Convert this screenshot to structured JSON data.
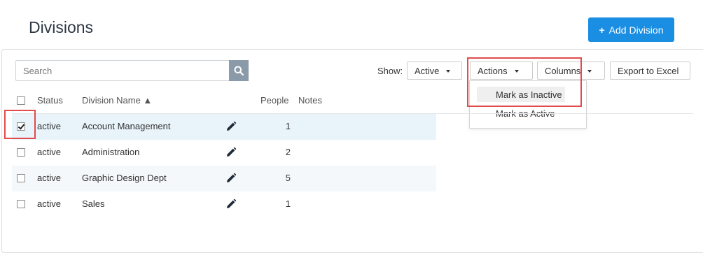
{
  "page": {
    "title": "Divisions"
  },
  "header": {
    "add_button_label": "Add Division",
    "add_button_icon": "plus-icon"
  },
  "toolbar": {
    "search_placeholder": "Search",
    "show_label": "Show:",
    "show_value": "Active",
    "actions_label": "Actions",
    "columns_label": "Columns",
    "export_label": "Export to Excel"
  },
  "actions_menu": {
    "items": [
      {
        "label": "Mark as Inactive",
        "highlighted": true
      },
      {
        "label": "Mark as Active",
        "highlighted": false
      }
    ]
  },
  "table": {
    "headers": {
      "status": "Status",
      "name": "Division Name ▲",
      "people": "People",
      "notes": "Notes"
    },
    "rows": [
      {
        "checked": true,
        "status": "active",
        "name": "Account Management",
        "people": "1"
      },
      {
        "checked": false,
        "status": "active",
        "name": "Administration",
        "people": "2"
      },
      {
        "checked": false,
        "status": "active",
        "name": "Graphic Design Dept",
        "people": "5"
      },
      {
        "checked": false,
        "status": "active",
        "name": "Sales",
        "people": "1"
      }
    ]
  },
  "colors": {
    "accent": "#1a8ee3",
    "highlight_box": "#e14c4c",
    "selected_row": "#e8f3fa",
    "alt_row": "#f5f8fa"
  }
}
